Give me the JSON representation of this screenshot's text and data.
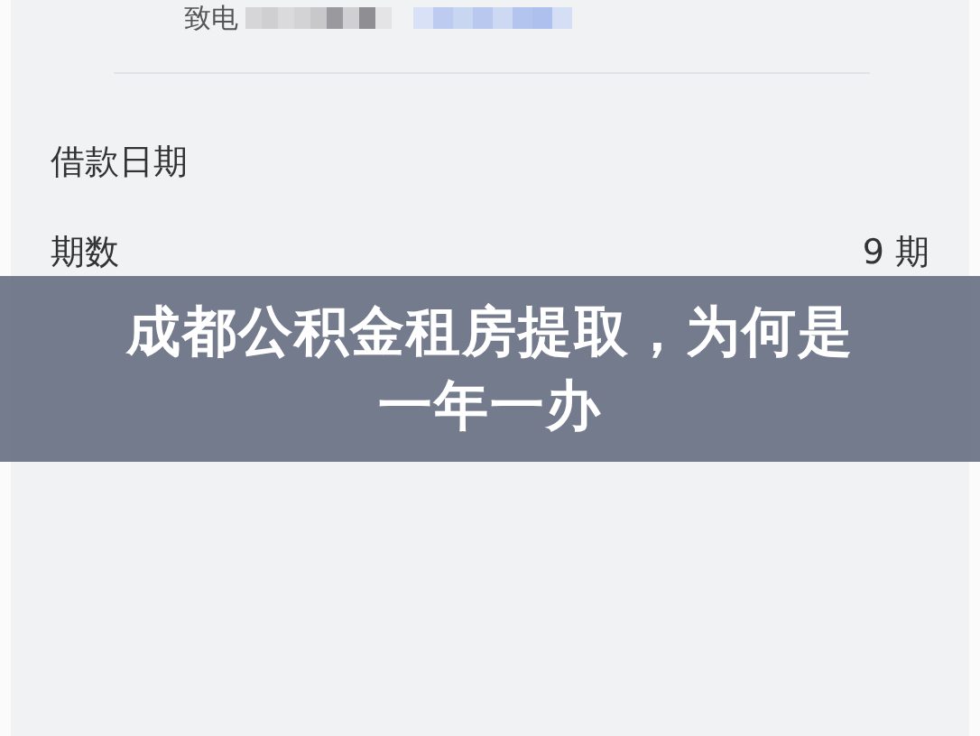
{
  "contact": {
    "label": "致电"
  },
  "section": {
    "title": "借款日期"
  },
  "rows": [
    {
      "label": "期数",
      "value": "9 期"
    }
  ],
  "banner": {
    "title": "成都公积金租房提取，为何是一年一办"
  }
}
